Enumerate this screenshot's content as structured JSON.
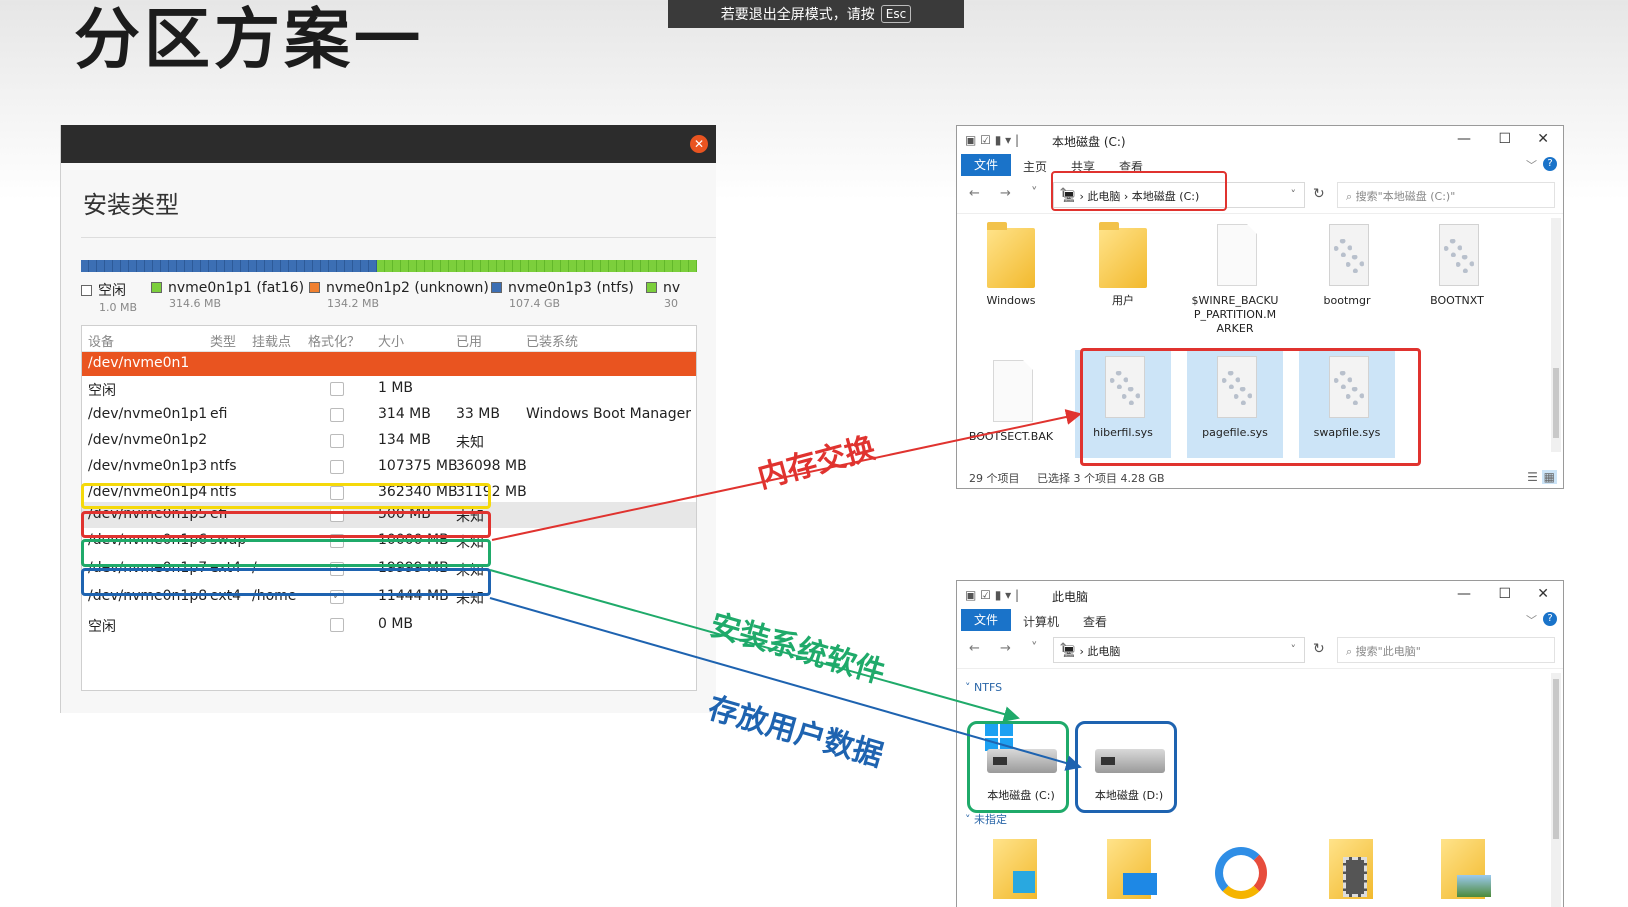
{
  "slide_title": "分区方案一",
  "fullscreen_hint": {
    "text": "若要退出全屏模式，请按",
    "key": "Esc"
  },
  "installer": {
    "close_glyph": "✕",
    "heading": "安装类型",
    "legend": [
      {
        "label": "空闲",
        "size": "1.0 MB",
        "color": "#ffffff"
      },
      {
        "label": "nvme0n1p1 (fat16)",
        "size": "314.6 MB",
        "color": "#7ccf3c"
      },
      {
        "label": "nvme0n1p2 (unknown)",
        "size": "134.2 MB",
        "color": "#f08030"
      },
      {
        "label": "nvme0n1p3 (ntfs)",
        "size": "107.4 GB",
        "color": "#3c6fb4"
      },
      {
        "label": "nv",
        "size": "30",
        "color": "#7ccf3c"
      }
    ],
    "columns": [
      "设备",
      "类型",
      "挂载点",
      "格式化？",
      "大小",
      "已用",
      "已装系统"
    ],
    "disk": "/dev/nvme0n1",
    "rows": [
      {
        "device": "空闲",
        "type": "",
        "mount": "",
        "format": false,
        "size": "1 MB",
        "used": "",
        "system": ""
      },
      {
        "device": "/dev/nvme0n1p1",
        "type": "efi",
        "mount": "",
        "format": false,
        "size": "314 MB",
        "used": "33 MB",
        "system": "Windows Boot Manager"
      },
      {
        "device": "/dev/nvme0n1p2",
        "type": "",
        "mount": "",
        "format": false,
        "size": "134 MB",
        "used": "未知",
        "system": ""
      },
      {
        "device": "/dev/nvme0n1p3",
        "type": "ntfs",
        "mount": "",
        "format": false,
        "size": "107375 MB",
        "used": "36098 MB",
        "system": ""
      },
      {
        "device": "/dev/nvme0n1p4",
        "type": "ntfs",
        "mount": "",
        "format": false,
        "size": "362340 MB",
        "used": "31192 MB",
        "system": ""
      },
      {
        "device": "/dev/nvme0n1p5",
        "type": "efi",
        "mount": "",
        "format": false,
        "size": "500 MB",
        "used": "未知",
        "system": ""
      },
      {
        "device": "/dev/nvme0n1p6",
        "type": "swap",
        "mount": "",
        "format": false,
        "size": "10000 MB",
        "used": "未知",
        "system": ""
      },
      {
        "device": "/dev/nvme0n1p7",
        "type": "ext4",
        "mount": "/",
        "format": true,
        "size": "19999 MB",
        "used": "未知",
        "system": ""
      },
      {
        "device": "/dev/nvme0n1p8",
        "type": "ext4",
        "mount": "/home",
        "format": true,
        "size": "11444 MB",
        "used": "未知",
        "system": ""
      },
      {
        "device": "空闲",
        "type": "",
        "mount": "",
        "format": false,
        "size": "0 MB",
        "used": "",
        "system": ""
      }
    ]
  },
  "annotations": {
    "memory_swap": "内存交换",
    "install_software": "安装系统软件",
    "user_data": "存放用户数据",
    "colors": {
      "red": "#e0332f",
      "green": "#1faa6a",
      "blue": "#1e63b0",
      "yellow": "#f5d90a"
    }
  },
  "explorer_c": {
    "title": "本地磁盘 (C:)",
    "tabs": [
      "文件",
      "主页",
      "共享",
      "查看"
    ],
    "path": [
      "此电脑",
      "本地磁盘 (C:)"
    ],
    "search_placeholder": "搜索\"本地磁盘 (C:)\"",
    "items": [
      {
        "name": "Windows",
        "icon": "folder-icon"
      },
      {
        "name": "用户",
        "icon": "folder-icon"
      },
      {
        "name": "$WINRE_BACKUP_PARTITION.MARKER",
        "icon": "file-icon"
      },
      {
        "name": "bootmgr",
        "icon": "system-file-icon"
      },
      {
        "name": "BOOTNXT",
        "icon": "system-file-icon"
      },
      {
        "name": "BOOTSECT.BAK",
        "icon": "file-icon"
      },
      {
        "name": "hiberfil.sys",
        "icon": "system-file-icon"
      },
      {
        "name": "pagefile.sys",
        "icon": "system-file-icon"
      },
      {
        "name": "swapfile.sys",
        "icon": "system-file-icon"
      }
    ],
    "status_count": "29 个项目",
    "status_selected": "已选择 3 个项目  4.28 GB"
  },
  "explorer_pc": {
    "title": "此电脑",
    "tabs": [
      "文件",
      "计算机",
      "查看"
    ],
    "path": [
      "此电脑"
    ],
    "search_placeholder": "搜索\"此电脑\"",
    "section_ntfs": "NTFS",
    "drives": [
      "本地磁盘 (C:)",
      "本地磁盘 (D:)"
    ],
    "section_unspecified": "未指定"
  },
  "window_controls": {
    "min": "—",
    "max": "☐",
    "close": "✕"
  }
}
